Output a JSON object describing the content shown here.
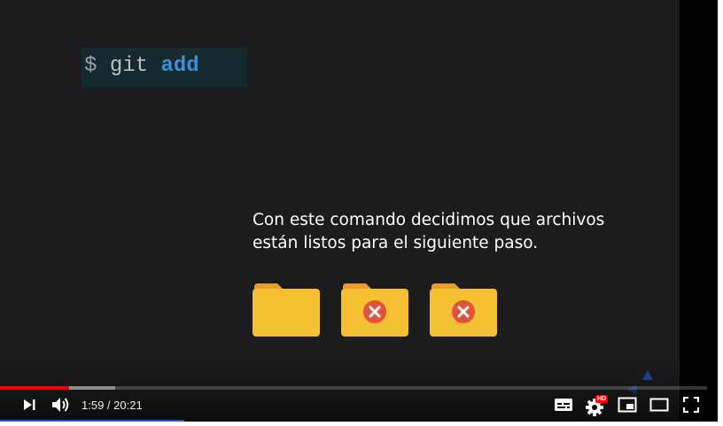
{
  "slide": {
    "command": {
      "prompt": "$",
      "word": "git",
      "argument": "add"
    },
    "caption_lines": [
      "Con este comando decidimos que archivos",
      "están listos para el siguiente paso."
    ],
    "folders": [
      {
        "icon": "folder-icon"
      },
      {
        "icon": "folder-x-icon"
      },
      {
        "icon": "folder-x-icon"
      }
    ],
    "colors": {
      "background": "#1c1b1e",
      "command_box": "#142a2e",
      "command_argument": "#3d8fd6",
      "folder": "#f4c032",
      "folder_tab": "#e89a2c",
      "error_badge": "#e2513a"
    }
  },
  "player": {
    "progress": {
      "played_fraction": 0.098,
      "buffered_fraction": 0.163
    },
    "time": {
      "current": "1:59",
      "separator": " / ",
      "duration": "20:21"
    },
    "quality_badge": "HD",
    "colors": {
      "played": "#ff0000"
    },
    "controls": [
      "next-icon",
      "volume-icon",
      "subtitles-icon",
      "settings-icon",
      "miniplayer-icon",
      "theater-mode-icon",
      "fullscreen-icon"
    ]
  }
}
